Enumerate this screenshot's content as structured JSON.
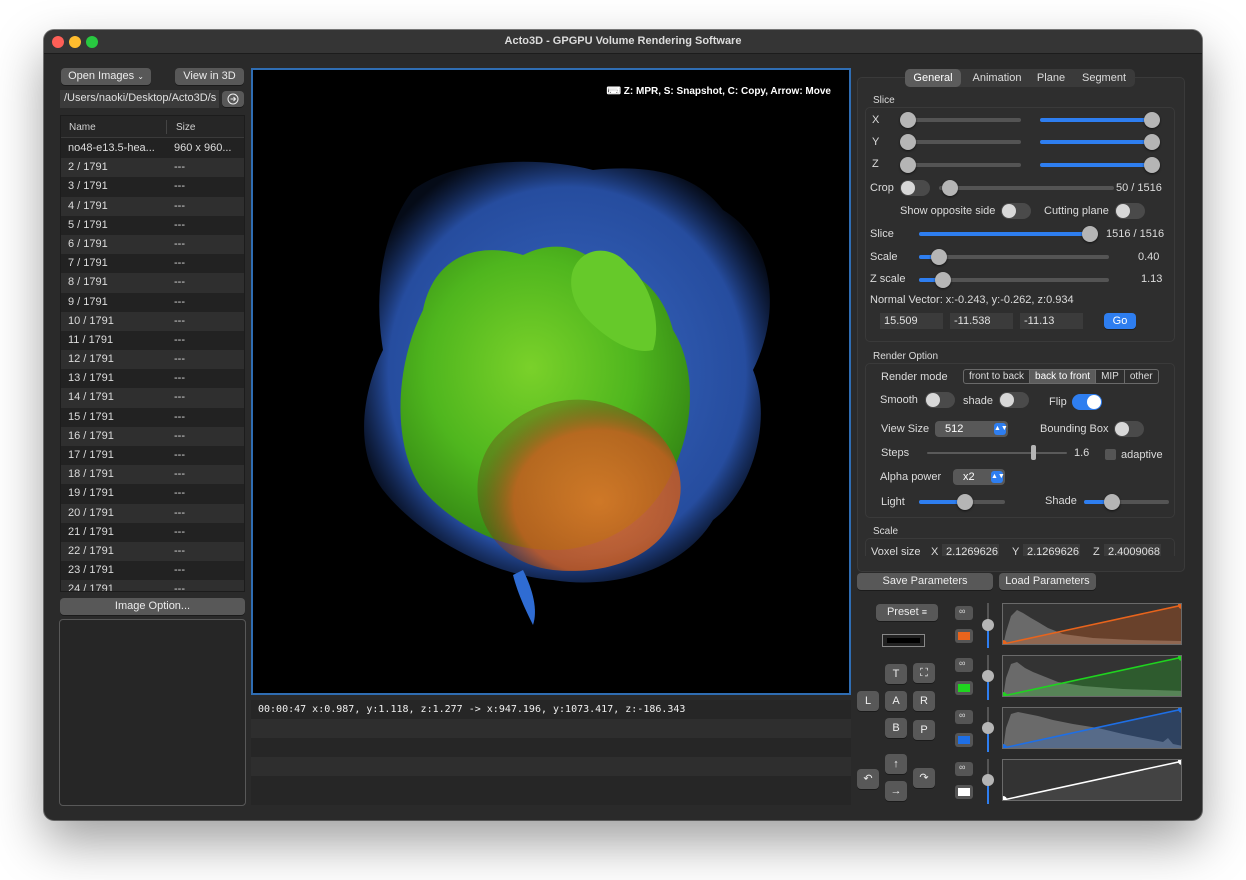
{
  "window": {
    "title": "Acto3D - GPGPU Volume Rendering Software"
  },
  "left": {
    "open_images": "Open Images",
    "view_in_3d": "View in 3D",
    "path": "/Users/naoki/Desktop/Acto3D/s",
    "columns": {
      "name": "Name",
      "size": "Size"
    },
    "files": [
      {
        "name": "no48-e13.5-hea...",
        "size": "960 x 960..."
      },
      {
        "name": "2 / 1791",
        "size": "---"
      },
      {
        "name": "3 / 1791",
        "size": "---"
      },
      {
        "name": "4 / 1791",
        "size": "---"
      },
      {
        "name": "5 / 1791",
        "size": "---"
      },
      {
        "name": "6 / 1791",
        "size": "---"
      },
      {
        "name": "7 / 1791",
        "size": "---"
      },
      {
        "name": "8 / 1791",
        "size": "---"
      },
      {
        "name": "9 / 1791",
        "size": "---"
      },
      {
        "name": "10 / 1791",
        "size": "---"
      },
      {
        "name": "11 / 1791",
        "size": "---"
      },
      {
        "name": "12 / 1791",
        "size": "---"
      },
      {
        "name": "13 / 1791",
        "size": "---"
      },
      {
        "name": "14 / 1791",
        "size": "---"
      },
      {
        "name": "15 / 1791",
        "size": "---"
      },
      {
        "name": "16 / 1791",
        "size": "---"
      },
      {
        "name": "17 / 1791",
        "size": "---"
      },
      {
        "name": "18 / 1791",
        "size": "---"
      },
      {
        "name": "19 / 1791",
        "size": "---"
      },
      {
        "name": "20 / 1791",
        "size": "---"
      },
      {
        "name": "21 / 1791",
        "size": "---"
      },
      {
        "name": "22 / 1791",
        "size": "---"
      },
      {
        "name": "23 / 1791",
        "size": "---"
      },
      {
        "name": "24 / 1791",
        "size": "---"
      }
    ],
    "image_option": "Image Option..."
  },
  "viewer": {
    "hint": "Z: MPR, S: Snapshot, C: Copy, Arrow: Move",
    "log": [
      "00:00:47 x:0.987, y:1.118, z:1.277 -> x:947.196, y:1073.417, z:-186.343"
    ]
  },
  "tabs": [
    "General",
    "Animation",
    "Plane",
    "Segment"
  ],
  "slice_section": {
    "title": "Slice",
    "x": "X",
    "y": "Y",
    "z": "Z",
    "crop": "Crop",
    "crop_value": "50 / 1516",
    "show_opposite": "Show opposite side",
    "cutting_plane": "Cutting plane",
    "slice": "Slice",
    "slice_value": "1516 / 1516",
    "scale": "Scale",
    "scale_value": "0.40",
    "zscale": "Z scale",
    "zscale_value": "1.13",
    "normal": "Normal Vector: x:-0.243, y:-0.262, z:0.934",
    "nx": "15.509",
    "ny": "-11.538",
    "nz": "-11.13",
    "go": "Go"
  },
  "render_section": {
    "title": "Render Option",
    "mode_label": "Render mode",
    "modes": [
      "front to back",
      "back to front",
      "MIP",
      "other"
    ],
    "smooth": "Smooth",
    "shade": "shade",
    "flip": "Flip",
    "view_size": "View Size",
    "view_size_value": "512",
    "bounding_box": "Bounding Box",
    "steps": "Steps",
    "steps_value": "1.6",
    "adaptive": "adaptive",
    "alpha_power": "Alpha power",
    "alpha_value": "x2",
    "light": "Light",
    "shade2": "Shade"
  },
  "scale_section": {
    "title": "Scale",
    "voxel_size": "Voxel size",
    "x": "X",
    "y": "Y",
    "z": "Z",
    "vx": "2.1269626",
    "vy": "2.1269626",
    "vz": "2.4009068"
  },
  "params": {
    "save": "Save Parameters",
    "load": "Load Parameters"
  },
  "tf": {
    "preset": "Preset",
    "views": {
      "T": "T",
      "L": "L",
      "A": "A",
      "R": "R",
      "B": "B",
      "P": "P"
    },
    "channel_colors": [
      "#e8641c",
      "#1fd41f",
      "#1e6fe6",
      "#ffffff"
    ]
  }
}
